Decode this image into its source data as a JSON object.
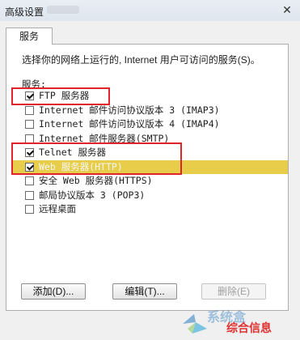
{
  "window": {
    "title": "高级设置",
    "close_glyph": "✕"
  },
  "tab": {
    "label": "服务"
  },
  "description": "选择你的网络上运行的, Internet 用户可访问的服务(S)。",
  "services_label": "服务:",
  "services": [
    {
      "label": "FTP 服务器",
      "checked": true
    },
    {
      "label": "Internet 邮件访问协议版本 3 (IMAP3)",
      "checked": false
    },
    {
      "label": "Internet 邮件访问协议版本 4 (IMAP4)",
      "checked": false
    },
    {
      "label": "Internet 邮件服务器(SMTP)",
      "checked": false
    },
    {
      "label": "Telnet 服务器",
      "checked": true
    },
    {
      "label": "Web 服务器(HTTP)",
      "checked": true,
      "selected": true
    },
    {
      "label": "安全 Web 服务器(HTTPS)",
      "checked": false
    },
    {
      "label": "邮局协议版本 3 (POP3)",
      "checked": false
    },
    {
      "label": "远程桌面",
      "checked": false
    }
  ],
  "buttons": {
    "add": "添加(D)...",
    "edit": "编辑(T)...",
    "delete": "删除(E)"
  },
  "watermark": {
    "brand": "综合信息",
    "domain": "系统盒"
  },
  "colors": {
    "selection": "#e7cd4a",
    "highlight_border": "#e0242b"
  }
}
